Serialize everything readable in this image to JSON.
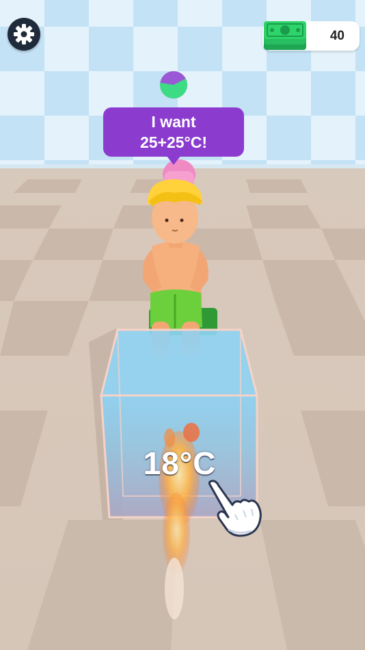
{
  "hud": {
    "cash": "40",
    "settings_icon": "gear-icon",
    "cash_icon": "banknote-stack-icon",
    "timer_icon": "pie-timer-icon",
    "timer_progress": 0.6
  },
  "customer": {
    "request_line1": "I want",
    "request_line2": "25+25°C!"
  },
  "tank": {
    "temperature": "18°C"
  },
  "hint": {
    "icon": "tap-hand-icon"
  },
  "colors": {
    "bubble": "#8b3ccf",
    "cash_green": "#2ed46a",
    "timer_green": "#3ddc84",
    "timer_purple": "#9a57d6",
    "water": "#7ec8ee"
  }
}
